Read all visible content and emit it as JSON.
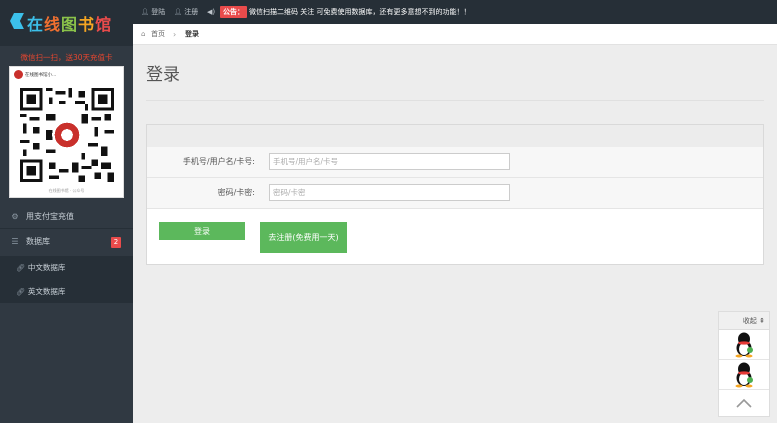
{
  "logo": {
    "chars": [
      "在",
      "线",
      "图",
      "书",
      "馆"
    ],
    "colors": [
      "#3cc0ea",
      "#f07030",
      "#8bc34a",
      "#f5a623",
      "#e94b4b"
    ]
  },
  "sidebar": {
    "scan_tip": "微信扫一扫，送30天充值卡",
    "qr": {
      "header": "在线图书馆小...",
      "footer": "在线图书馆 · 公众号"
    },
    "items": [
      {
        "label": "用支付宝充值",
        "icon": "gear-icon"
      },
      {
        "label": "数据库",
        "icon": "list-icon",
        "badge": "2"
      }
    ],
    "sub_items": [
      {
        "label": "中文数据库",
        "icon": "link-icon"
      },
      {
        "label": "英文数据库",
        "icon": "link-icon"
      }
    ]
  },
  "topbar": {
    "login": "登陆",
    "register": "注册",
    "notice_badge": "公告：",
    "notice_text": "微信扫描二维码 关注 可免费使用数据库，还有更多意想不到的功能！！"
  },
  "breadcrumb": {
    "home": "首页",
    "current": "登录"
  },
  "main": {
    "title": "登录",
    "form": {
      "account_label": "手机号/用户名/卡号:",
      "account_placeholder": "手机号/用户名/卡号",
      "password_label": "密码/卡密:",
      "password_placeholder": "密码/卡密",
      "login_button": "登录",
      "register_button": "去注册(免费用一天)"
    }
  },
  "float": {
    "collapse": "收起"
  },
  "colors": {
    "accent_green": "#5cb85c",
    "badge_red": "#e94b4b",
    "sidebar_bg": "#303942"
  }
}
